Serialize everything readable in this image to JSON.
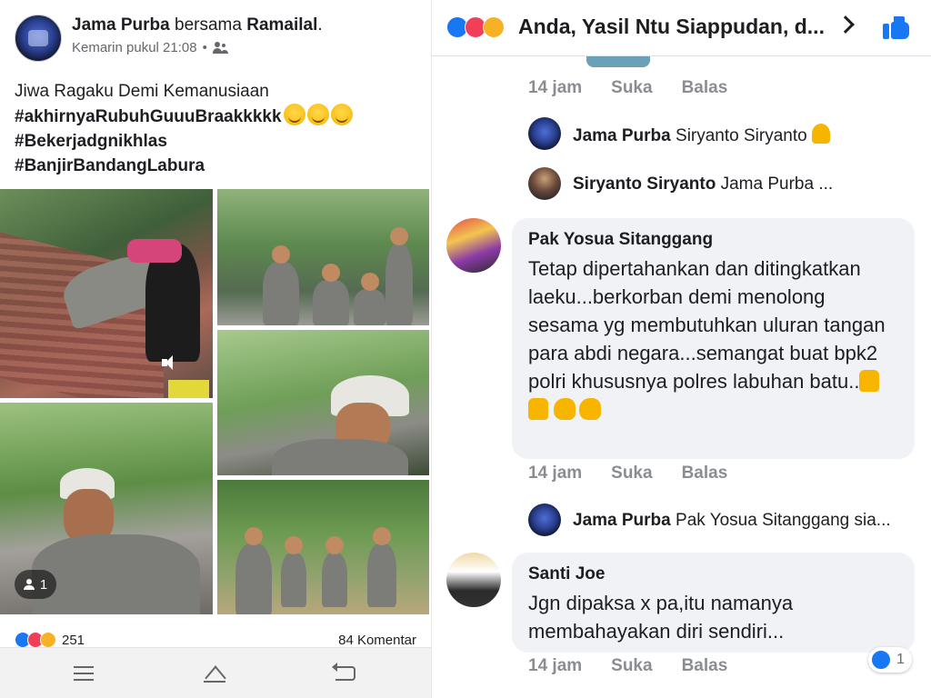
{
  "post": {
    "author": "Jama Purba",
    "with_word": "bersama",
    "tagged": "Ramailal",
    "timestamp": "Kemarin pukul 21:08",
    "audience_icon": "friends-icon",
    "text_line1": "Jiwa Ragaku Demi Kemanusiaan",
    "hashtag1": "#akhirnyaRubuhGuuuBraakkkkk",
    "hashtag2": "#Bekerjadgnikhlas",
    "hashtag3": "#BanjirBandangLabura",
    "tag_count": "1",
    "reaction_count": "251",
    "comment_count": "84 Komentar"
  },
  "comments_header": {
    "title": "Anda, Yasil Ntu Siappudan, d..."
  },
  "actions": {
    "time": "14 jam",
    "like": "Suka",
    "reply": "Balas"
  },
  "replies": [
    {
      "author": "Jama Purba",
      "text": "Siryanto Siryanto"
    },
    {
      "author": "Siryanto Siryanto",
      "text": "Jama Purba ..."
    },
    {
      "author": "Jama Purba",
      "text": "Pak Yosua Sitanggang sia..."
    }
  ],
  "comments": [
    {
      "author": "Pak Yosua Sitanggang",
      "text": "Tetap dipertahankan dan ditingkatkan laeku...berkorban demi menolong sesama yg membutuhkan uluran tangan para abdi negara...semangat buat bpk2 polri khususnya polres labuhan batu.."
    },
    {
      "author": "Santi Joe",
      "text": "Jgn dipaksa x pa,itu namanya membahayakan diri sendiri...",
      "reaction_count": "1"
    }
  ],
  "colors": {
    "like": "#1877f2",
    "love": "#f33e58",
    "wow": "#f7b125",
    "muted_text": "#65676b",
    "bubble_bg": "#f0f2f5"
  }
}
